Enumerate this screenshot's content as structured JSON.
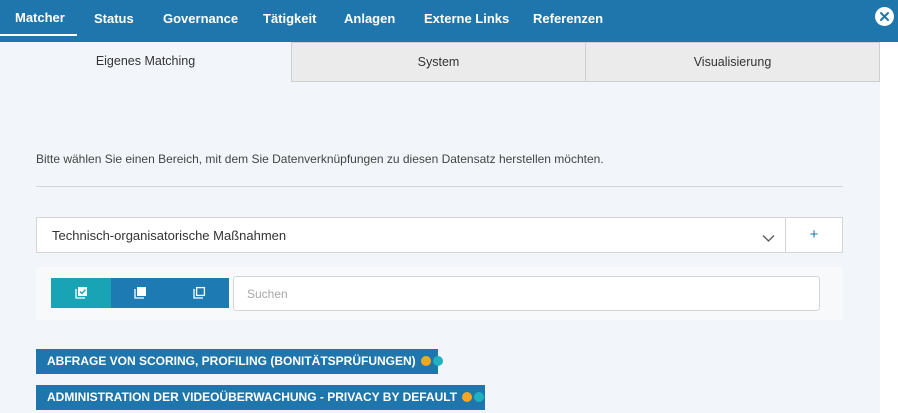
{
  "top_tabs": [
    {
      "label": "Matcher",
      "active": true
    },
    {
      "label": "Status"
    },
    {
      "label": "Governance"
    },
    {
      "label": "Tätigkeit"
    },
    {
      "label": "Anlagen"
    },
    {
      "label": "Externe Links"
    },
    {
      "label": "Referenzen"
    }
  ],
  "close_icon": "close-icon",
  "sub_tabs": [
    {
      "label": "Eigenes Matching",
      "active": true
    },
    {
      "label": "System"
    },
    {
      "label": "Visualisierung"
    }
  ],
  "main": {
    "hint": "Bitte wählen Sie einen Bereich, mit dem Sie Datenverknüpfungen zu diesen Datensatz herstellen möchten.",
    "select_value": "Technisch-organisatorische Maßnahmen",
    "plus_label": "+",
    "search_placeholder": "Suchen",
    "view_buttons": [
      "check-stack-icon",
      "stack-icon",
      "copy-icon"
    ]
  },
  "tags": [
    {
      "label": "ABFRAGE VON SCORING, PROFILING (BONITÄTSPRÜFUNGEN)",
      "dots": [
        "orange",
        "teal"
      ]
    },
    {
      "label": "ADMINISTRATION DER VIDEOÜBERWACHUNG - PRIVACY BY DEFAULT",
      "dots": [
        "orange",
        "teal"
      ]
    }
  ],
  "colors": {
    "header": "#1f76ad",
    "accent_teal": "#19a4b5",
    "dot_orange": "#f5a623",
    "dot_teal": "#1fb0c2",
    "panel": "#f2f6fa"
  }
}
